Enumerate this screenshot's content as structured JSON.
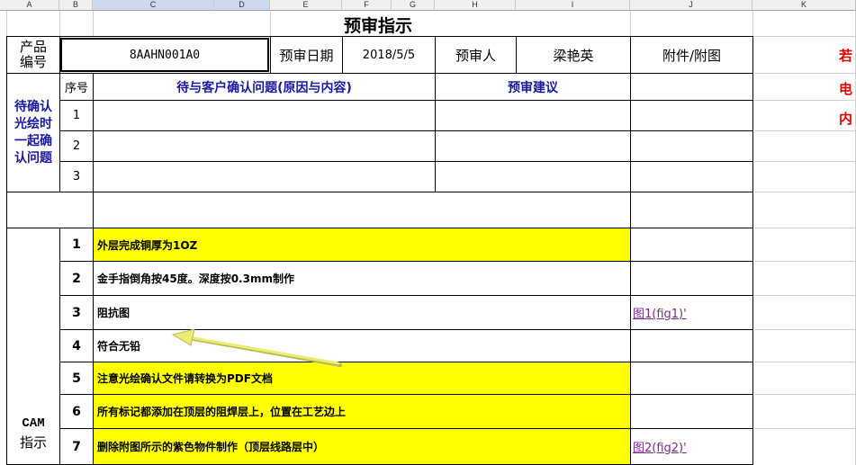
{
  "columns": [
    "A",
    "B",
    "C",
    "D",
    "E",
    "F",
    "G",
    "H",
    "I",
    "J",
    "K"
  ],
  "title": "预审指示",
  "header": {
    "product_no_label": "产品编号",
    "product_no": "8AAHN001A0",
    "review_date_label": "预审日期",
    "review_date": "2018/5/5",
    "reviewer_label": "预审人",
    "reviewer": "梁艳英",
    "attachment_label": "附件/附图"
  },
  "pending": {
    "side_label": "待确认光绘时一起确认问题",
    "seq_label": "序号",
    "issue_header": "待与客户确认问题(原因与内容)",
    "advice_header": "预审建议",
    "rows": [
      "1",
      "2",
      "3"
    ]
  },
  "cam": {
    "side_label_1": "CAM",
    "side_label_2": "指示",
    "items": [
      {
        "no": "1",
        "text": "外层完成铜厚为1OZ",
        "highlight": true,
        "link": ""
      },
      {
        "no": "2",
        "text": "金手指倒角按45度。深度按0.3mm制作",
        "highlight": false,
        "link": ""
      },
      {
        "no": "3",
        "text": "阻抗图",
        "highlight": false,
        "link": "图1(fig1)'"
      },
      {
        "no": "4",
        "text": "符合无铅",
        "highlight": false,
        "link": ""
      },
      {
        "no": "5",
        "text": "注意光绘确认文件请转换为PDF文档",
        "highlight": true,
        "link": ""
      },
      {
        "no": "6",
        "text": "所有标记都添加在顶层的阻焊层上，位置在工艺边上",
        "highlight": true,
        "link": ""
      },
      {
        "no": "7",
        "text": "删除附图所示的紫色物件制作（顶层线路层中）",
        "highlight": true,
        "link": "图2(fig2)'"
      }
    ]
  },
  "side_note": [
    "若",
    "电",
    "内"
  ],
  "colors": {
    "highlight": "#ffff00",
    "label_blue": "#1a1aa0",
    "note_red": "#e00000",
    "link_purple": "#7a2a8a",
    "arrow": "#e8e870"
  }
}
